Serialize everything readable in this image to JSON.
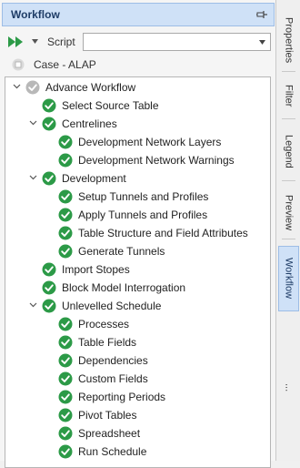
{
  "panel": {
    "title": "Workflow"
  },
  "toolbar": {
    "script_label": "Script",
    "script_value": ""
  },
  "case": {
    "label": "Case - ALAP"
  },
  "colors": {
    "accent": "#cfe1f7",
    "check": "#2c9a47",
    "run": "#2c9a47",
    "pending": "#b8b8b8"
  },
  "tree": [
    {
      "label": "Advance Workflow",
      "level": 0,
      "expander": "expanded",
      "status": "pending"
    },
    {
      "label": "Select Source Table",
      "level": 1,
      "expander": "none",
      "status": "done"
    },
    {
      "label": "Centrelines",
      "level": 1,
      "expander": "expanded",
      "status": "done"
    },
    {
      "label": "Development Network Layers",
      "level": 2,
      "expander": "none",
      "status": "done"
    },
    {
      "label": "Development Network Warnings",
      "level": 2,
      "expander": "none",
      "status": "done"
    },
    {
      "label": "Development",
      "level": 1,
      "expander": "expanded",
      "status": "done"
    },
    {
      "label": "Setup Tunnels and Profiles",
      "level": 2,
      "expander": "none",
      "status": "done"
    },
    {
      "label": "Apply Tunnels and Profiles",
      "level": 2,
      "expander": "none",
      "status": "done"
    },
    {
      "label": "Table Structure and Field Attributes",
      "level": 2,
      "expander": "none",
      "status": "done"
    },
    {
      "label": "Generate Tunnels",
      "level": 2,
      "expander": "none",
      "status": "done"
    },
    {
      "label": "Import Stopes",
      "level": 1,
      "expander": "none",
      "status": "done"
    },
    {
      "label": "Block Model Interrogation",
      "level": 1,
      "expander": "none",
      "status": "done"
    },
    {
      "label": "Unlevelled Schedule",
      "level": 1,
      "expander": "expanded",
      "status": "done"
    },
    {
      "label": "Processes",
      "level": 2,
      "expander": "none",
      "status": "done"
    },
    {
      "label": "Table Fields",
      "level": 2,
      "expander": "none",
      "status": "done"
    },
    {
      "label": "Dependencies",
      "level": 2,
      "expander": "none",
      "status": "done"
    },
    {
      "label": "Custom Fields",
      "level": 2,
      "expander": "none",
      "status": "done"
    },
    {
      "label": "Reporting Periods",
      "level": 2,
      "expander": "none",
      "status": "done"
    },
    {
      "label": "Pivot Tables",
      "level": 2,
      "expander": "none",
      "status": "done"
    },
    {
      "label": "Spreadsheet",
      "level": 2,
      "expander": "none",
      "status": "done"
    },
    {
      "label": "Run Schedule",
      "level": 2,
      "expander": "none",
      "status": "done"
    }
  ],
  "side_tabs": [
    {
      "label": "Properties",
      "active": false
    },
    {
      "label": "Filter",
      "active": false
    },
    {
      "label": "Legend",
      "active": false
    },
    {
      "label": "Preview",
      "active": false
    },
    {
      "label": "Workflow",
      "active": true
    },
    {
      "label": "...",
      "active": false
    }
  ]
}
